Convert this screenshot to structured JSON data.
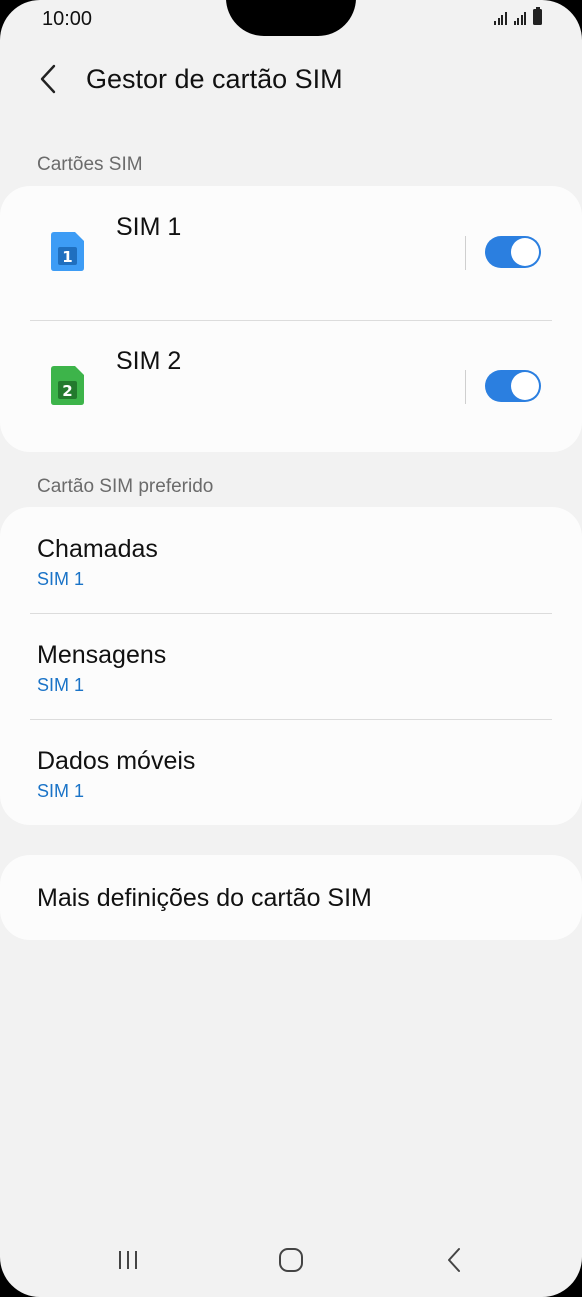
{
  "status_bar": {
    "time": "10:00",
    "icons": [
      "signal-icon",
      "signal-icon",
      "battery-icon"
    ]
  },
  "header": {
    "title": "Gestor de cartão SIM",
    "back_icon": "chevron-left-icon"
  },
  "sim_cards": {
    "section_label": "Cartões SIM",
    "items": [
      {
        "name": "SIM 1",
        "badge": "1",
        "color": "#3d9cf5",
        "enabled": true
      },
      {
        "name": "SIM 2",
        "badge": "2",
        "color": "#3db44a",
        "enabled": true
      }
    ],
    "toggle_color": "#2b7fe0"
  },
  "preferred": {
    "section_label": "Cartão SIM preferido",
    "items": [
      {
        "title": "Chamadas",
        "value": "SIM 1"
      },
      {
        "title": "Mensagens",
        "value": "SIM 1"
      },
      {
        "title": "Dados móveis",
        "value": "SIM 1"
      }
    ],
    "accent": "#1a73c7"
  },
  "more": {
    "label": "Mais definições do cartão SIM"
  },
  "navbar": {
    "icons": [
      "recent-apps-icon",
      "home-icon",
      "back-icon"
    ]
  }
}
